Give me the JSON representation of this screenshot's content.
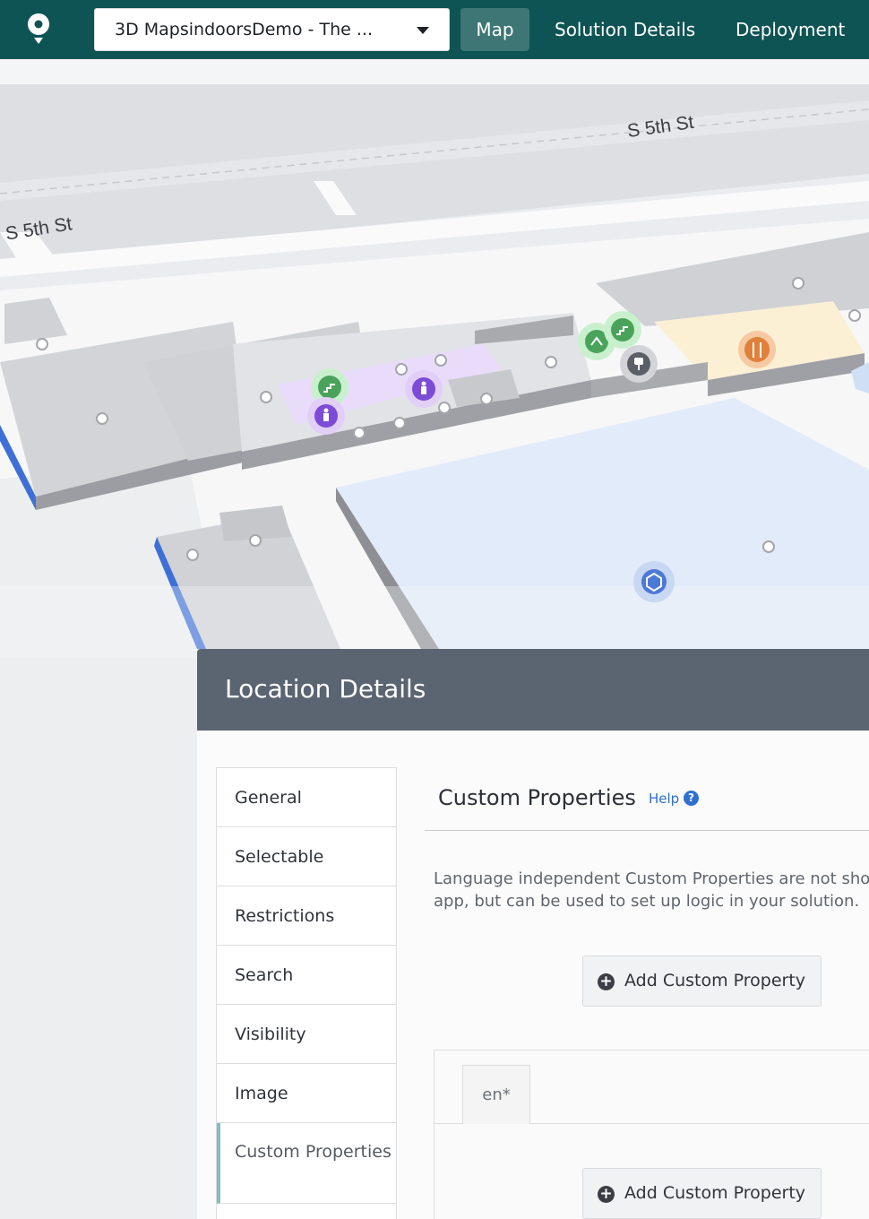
{
  "topbar": {
    "venue_select": "3D MapsindoorsDemo - The ...",
    "nav": {
      "map": "Map",
      "solution_details": "Solution Details",
      "deployment": "Deployment"
    },
    "colors": {
      "bar": "#0f5454",
      "active_tab": "#3d7675"
    }
  },
  "map": {
    "streets": [
      "S 5th St",
      "S 5th St"
    ],
    "icons": [
      "toilet-icon",
      "stairs-icon",
      "escalator-icon",
      "restaurant-icon",
      "office-chair-icon",
      "cube-icon"
    ]
  },
  "location_details": {
    "title": "Location Details",
    "menu": [
      "General",
      "Selectable",
      "Restrictions",
      "Search",
      "Visibility",
      "Image",
      "Custom Properties"
    ],
    "active_menu": "Custom Properties",
    "custom_properties": {
      "title": "Custom Properties",
      "help": "Help",
      "help_icon": "?",
      "description_lines": [
        "Language independent Custom Properties are not shown in the",
        "app, but can be used to set up logic in your solution."
      ],
      "add_button": "Add Custom Property",
      "add_icon": "+",
      "language_tab": "en*",
      "add_button_2": "Add Custom Property"
    }
  }
}
